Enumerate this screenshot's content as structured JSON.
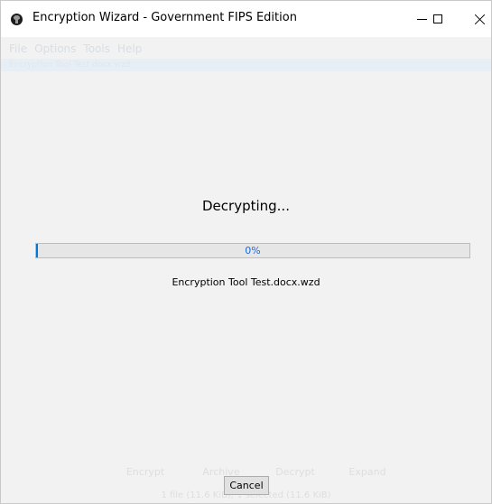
{
  "window": {
    "title": "Encryption Wizard - Government FIPS Edition",
    "icon": "app-shield-icon",
    "controls": {
      "minimize": "minimize-icon",
      "maximize": "maximize-icon",
      "close": "close-icon"
    }
  },
  "menu": {
    "items": [
      "File",
      "Options",
      "Tools",
      "Help"
    ]
  },
  "path": {
    "text": "Encryption Tool Test.docx.wzd"
  },
  "status": {
    "title": "Decrypting...",
    "progress_text": "0%",
    "progress_fraction": 0.0,
    "filename": "Encryption Tool Test.docx.wzd"
  },
  "background_buttons": [
    "Encrypt",
    "Archive",
    "Decrypt",
    "Expand"
  ],
  "background_status": "1 file (11.6 KiB), 1 selected (11.6 KiB)",
  "cancel_label": "Cancel",
  "colors": {
    "progress_accent": "#0078d7",
    "progress_text": "#1e6bd6"
  }
}
